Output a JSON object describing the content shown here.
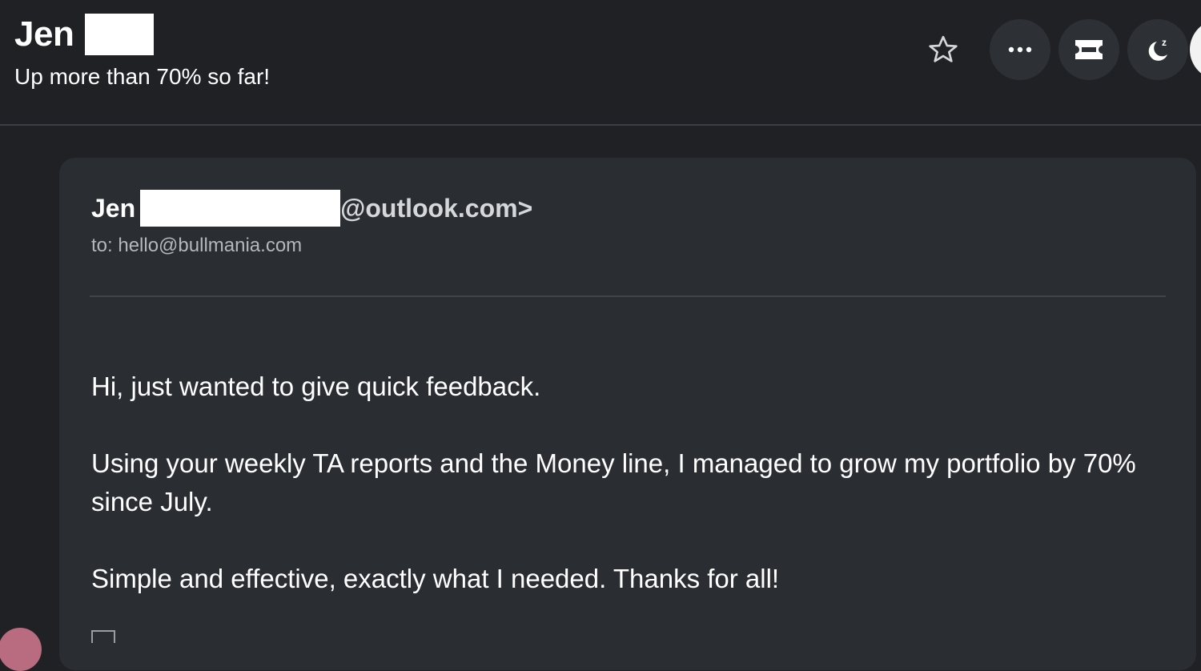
{
  "header": {
    "sender_first_name": "Jen",
    "subject": "Up more than 70% so far!"
  },
  "actions": {
    "star_icon": "star-outline-icon",
    "more_icon": "more-horizontal-icon",
    "ticket_icon": "ticket-icon",
    "snooze_icon": "snooze-moon-icon"
  },
  "email": {
    "from_name": "Jen",
    "from_email_suffix": "@outlook.com>",
    "to": "to: hello@bullmania.com",
    "body": [
      "Hi, just wanted to give quick feedback.",
      "Using your weekly TA reports and the Money line, I managed to grow my portfolio by 70% since July.",
      "Simple and effective, exactly what I needed. Thanks for all!"
    ]
  },
  "colors": {
    "background": "#1f2125",
    "card": "#2a2d32",
    "button": "#2d3035",
    "muted_text": "#b4b7bc",
    "avatar_bottom": "#b96b80"
  }
}
